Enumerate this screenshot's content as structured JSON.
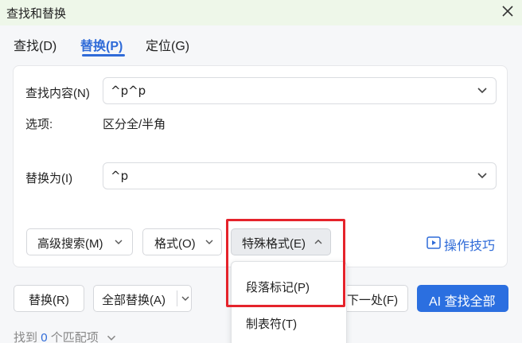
{
  "window": {
    "title": "查找和替换"
  },
  "tabs": [
    {
      "label": "查找(D)",
      "active": false
    },
    {
      "label": "替换(P)",
      "active": true
    },
    {
      "label": "定位(G)",
      "active": false
    }
  ],
  "find": {
    "label": "查找内容(N)",
    "value": "^p^p"
  },
  "options": {
    "label": "选项:",
    "value": "区分全/半角"
  },
  "replace": {
    "label": "替换为(I)",
    "value": "^p"
  },
  "buttons": {
    "advanced_search": "高级搜索(M)",
    "format": "格式(O)",
    "special_format": "特殊格式(E)",
    "tips": "操作技巧",
    "replace": "替换(R)",
    "replace_all": "全部替换(A)",
    "find_next": "下一处(F)",
    "ai_find_all": "AI 查找全部"
  },
  "special_menu": {
    "items": [
      "段落标记(P)",
      "制表符(T)"
    ]
  },
  "footer": {
    "prefix": "找到",
    "count": "0",
    "suffix": "个匹配项"
  },
  "colors": {
    "accent": "#2f6bd8",
    "primary_button": "#2b6fe0",
    "highlight": "#e5232b",
    "titlebar": "#eef7e9"
  }
}
